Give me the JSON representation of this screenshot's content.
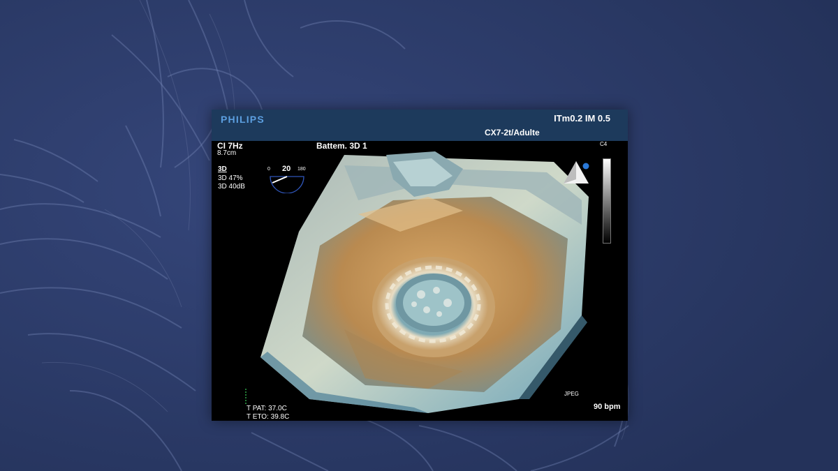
{
  "monitor": {
    "brand": "PHILIPS",
    "header_right_line1": "ITm0.2  IM 0.5",
    "header_right_line2": "CX7-2t/Adulte",
    "frequency": "CI 7Hz",
    "depth": "8.7cm",
    "mode": "3D",
    "gain": "3D 47%",
    "compression": "3D 40dB",
    "acquisition": "Battem. 3D 1",
    "colormap": "C4",
    "format": "JPEG",
    "heart_rate": "90 bpm",
    "temp_pat": "T PAT: 37.0C",
    "temp_eto": "T ETO: 39.8C",
    "protractor": {
      "min_label": "0",
      "value_label": "20",
      "max_label": "180"
    }
  },
  "colors": {
    "background": "#2a3a63",
    "header_bar": "#1d3a5c",
    "brand_blue": "#5c9fe0",
    "tissue_gold": "#c99a55",
    "tissue_cyan": "#8ec9d6"
  },
  "icons": {
    "protractor": "angle-indicator-icon",
    "probe": "probe-orientation-icon",
    "ecg": "ecg-trace-icon"
  }
}
